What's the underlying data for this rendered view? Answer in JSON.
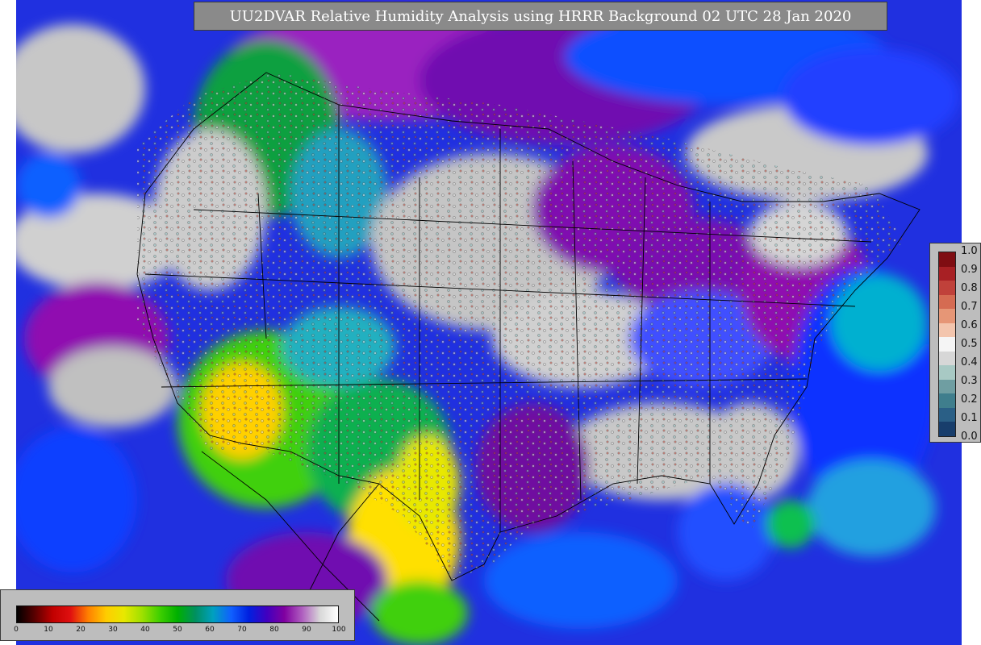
{
  "title": "UU2DVAR Relative Humidity Analysis using HRRR Background 02 UTC 28 Jan 2020",
  "obs_legend": {
    "ticks": [
      "1.0",
      "0.9",
      "0.8",
      "0.7",
      "0.6",
      "0.5",
      "0.4",
      "0.3",
      "0.2",
      "0.1",
      "0.0"
    ],
    "colors": [
      "#7f0d12",
      "#a82024",
      "#c0413a",
      "#d56b52",
      "#e69676",
      "#f3c5ad",
      "#f5f5f5",
      "#d7d7d7",
      "#a8c9c4",
      "#6f9ea2",
      "#3f7e8d",
      "#2a5f86",
      "#183e6c"
    ]
  },
  "rh_colorbar": {
    "ticks": [
      "0",
      "10",
      "20",
      "30",
      "40",
      "50",
      "60",
      "70",
      "80",
      "90",
      "100"
    ],
    "colors": [
      "#000000",
      "#5a0000",
      "#c00000",
      "#e01010",
      "#ff8000",
      "#ffcc00",
      "#e8e800",
      "#a0e000",
      "#40d000",
      "#00b000",
      "#009060",
      "#00a0c0",
      "#1060ff",
      "#0020e0",
      "#4000c0",
      "#8000a0",
      "#b060c0",
      "#d8d8d8",
      "#ffffff"
    ]
  }
}
